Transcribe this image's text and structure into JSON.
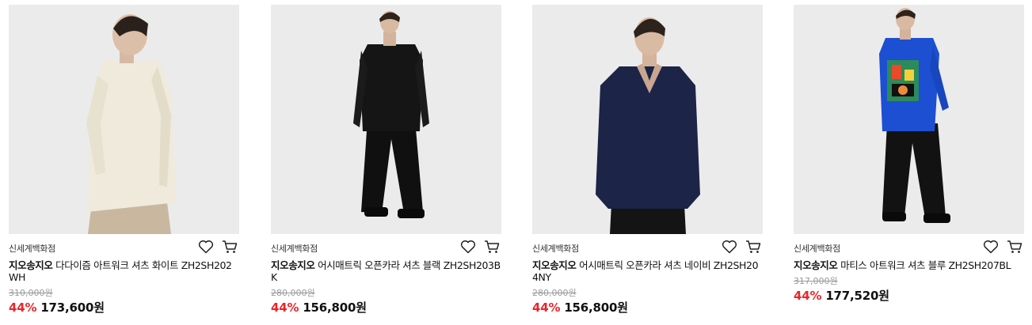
{
  "accent_discount_color": "#e8262b",
  "products": [
    {
      "store": "신세계백화점",
      "brand": "지오송지오",
      "name": "다다이즘 아트워크 셔츠 화이트 ZH2SH202WH",
      "original_price": "310,000원",
      "discount": "44%",
      "price": "173,600원",
      "shirt_color": "#efeadb",
      "pants_color": "#c9b89f"
    },
    {
      "store": "신세계백화점",
      "brand": "지오송지오",
      "name": "어시매트릭 오픈카라 셔츠 블랙 ZH2SH203BK",
      "original_price": "280,000원",
      "discount": "44%",
      "price": "156,800원",
      "shirt_color": "#151515",
      "pants_color": "#101010"
    },
    {
      "store": "신세계백화점",
      "brand": "지오송지오",
      "name": "어시매트릭 오픈카라 셔츠 네이비 ZH2SH204NY",
      "original_price": "280,000원",
      "discount": "44%",
      "price": "156,800원",
      "shirt_color": "#1c2447",
      "pants_color": "#141414"
    },
    {
      "store": "신세계백화점",
      "brand": "지오송지오",
      "name": "마티스 아트워크 셔츠 블루 ZH2SH207BL",
      "original_price": "317,000원",
      "discount": "44%",
      "price": "177,520원",
      "shirt_color": "#1c4fd1",
      "pants_color": "#121212"
    }
  ],
  "icons": {
    "wishlist": "heart-icon",
    "cart": "cart-icon"
  }
}
